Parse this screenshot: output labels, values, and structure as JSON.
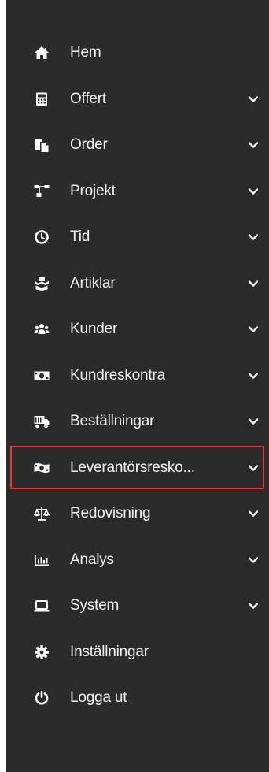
{
  "sidebar": {
    "items": [
      {
        "label": "Hem",
        "icon": "home-icon",
        "expandable": false
      },
      {
        "label": "Offert",
        "icon": "calculator-icon",
        "expandable": true
      },
      {
        "label": "Order",
        "icon": "copy-document-icon",
        "expandable": true
      },
      {
        "label": "Projekt",
        "icon": "sitemap-icon",
        "expandable": true
      },
      {
        "label": "Tid",
        "icon": "clock-icon",
        "expandable": true
      },
      {
        "label": "Artiklar",
        "icon": "boxes-icon",
        "expandable": true
      },
      {
        "label": "Kunder",
        "icon": "users-icon",
        "expandable": true
      },
      {
        "label": "Kundreskontra",
        "icon": "money-bill-icon",
        "expandable": true
      },
      {
        "label": "Beställningar",
        "icon": "truck-icon",
        "expandable": true
      },
      {
        "label": "Leverantörsresko...",
        "icon": "money-bill-wave-icon",
        "expandable": true,
        "highlighted": true
      },
      {
        "label": "Redovisning",
        "icon": "balance-scale-icon",
        "expandable": true
      },
      {
        "label": "Analys",
        "icon": "bar-chart-icon",
        "expandable": true
      },
      {
        "label": "System",
        "icon": "laptop-icon",
        "expandable": true
      },
      {
        "label": "Inställningar",
        "icon": "cog-icon",
        "expandable": false
      },
      {
        "label": "Logga ut",
        "icon": "power-icon",
        "expandable": false
      }
    ]
  },
  "colors": {
    "background": "#2b2b2b",
    "text": "#f2f2f2",
    "icon": "#ffffff",
    "highlight_border": "#e53935"
  }
}
